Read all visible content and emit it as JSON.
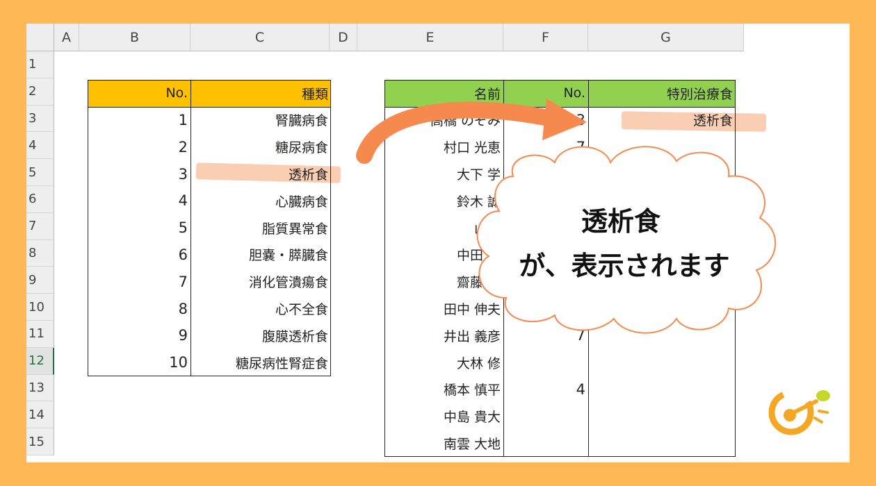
{
  "columns": [
    "A",
    "B",
    "C",
    "D",
    "E",
    "F",
    "G"
  ],
  "rows": [
    "1",
    "2",
    "3",
    "4",
    "5",
    "6",
    "7",
    "8",
    "9",
    "10",
    "11",
    "12",
    "13",
    "14",
    "15"
  ],
  "active_row": "12",
  "table1": {
    "headers": [
      "No.",
      "種類"
    ],
    "rows": [
      [
        "1",
        "腎臓病食"
      ],
      [
        "2",
        "糖尿病食"
      ],
      [
        "3",
        "透析食"
      ],
      [
        "4",
        "心臓病食"
      ],
      [
        "5",
        "脂質異常食"
      ],
      [
        "6",
        "胆嚢・膵臓食"
      ],
      [
        "7",
        "消化管潰瘍食"
      ],
      [
        "8",
        "心不全食"
      ],
      [
        "9",
        "腹膜透析食"
      ],
      [
        "10",
        "糖尿病性腎症食"
      ]
    ]
  },
  "table2": {
    "headers": [
      "名前",
      "No.",
      "特別治療食"
    ],
    "rows": [
      [
        "高橋 のぞみ",
        "3",
        "透析食"
      ],
      [
        "村口 光恵",
        "7",
        ""
      ],
      [
        "大下 学",
        "",
        ""
      ],
      [
        "鈴木 誠",
        "",
        ""
      ],
      [
        "山田",
        "",
        ""
      ],
      [
        "中田 充",
        "",
        ""
      ],
      [
        "齋藤 昌",
        "",
        ""
      ],
      [
        "田中 伸夫",
        "",
        ""
      ],
      [
        "井出 義彦",
        "7",
        ""
      ],
      [
        "大林 修",
        "",
        ""
      ],
      [
        "橋本 慎平",
        "4",
        ""
      ],
      [
        "中島 貴大",
        "",
        ""
      ],
      [
        "南雲 大地",
        "",
        ""
      ]
    ]
  },
  "callout": {
    "line1": "透析食",
    "line2": "が、表示されます"
  },
  "colors": {
    "background": "#FFB856",
    "header_orange": "#FFC000",
    "header_green": "#92D050",
    "arrow": "#F5894E",
    "highlight": "#F9C6A6",
    "cloud_stroke": "#F5894E"
  },
  "logo_icon": "spoon-logo-icon"
}
